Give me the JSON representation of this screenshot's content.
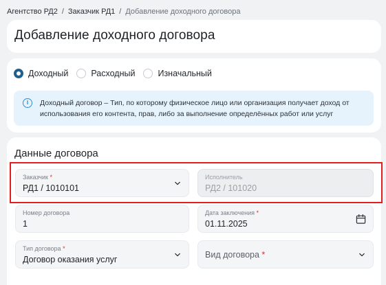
{
  "breadcrumb": {
    "items": [
      "Агентство РД2",
      "Заказчик РД1",
      "Добавление доходного договора"
    ],
    "separator": "/"
  },
  "header": {
    "title": "Добавление доходного договора"
  },
  "contract_type": {
    "options": [
      {
        "label": "Доходный",
        "checked": true
      },
      {
        "label": "Расходный",
        "checked": false
      },
      {
        "label": "Изначальный",
        "checked": false
      }
    ],
    "info_icon": "info-icon",
    "info_text": "Доходный договор – Тип, по которому физическое лицо или организация получает доход от использования его контента, прав, либо за выполнение определённых работ или услуг"
  },
  "contract_data": {
    "title": "Данные договора",
    "customer": {
      "label": "Заказчик",
      "required_mark": "*",
      "value": "РД1 / 1010101"
    },
    "executor": {
      "label": "Исполнитель",
      "value": "РД2 / 101020"
    },
    "number": {
      "label": "Номер договора",
      "value": "1"
    },
    "date": {
      "label": "Дата заключения",
      "required_mark": "*",
      "value": "01.11.2025"
    },
    "type": {
      "label": "Тип договора",
      "required_mark": "*",
      "value": "Договор оказания услуг"
    },
    "kind": {
      "label": "Вид договора",
      "required_mark": "*",
      "value": ""
    }
  },
  "colors": {
    "accent": "#1f5f8b",
    "info_bg": "#e6f3fc",
    "required": "#d6322c",
    "highlight": "#e01e1e"
  }
}
